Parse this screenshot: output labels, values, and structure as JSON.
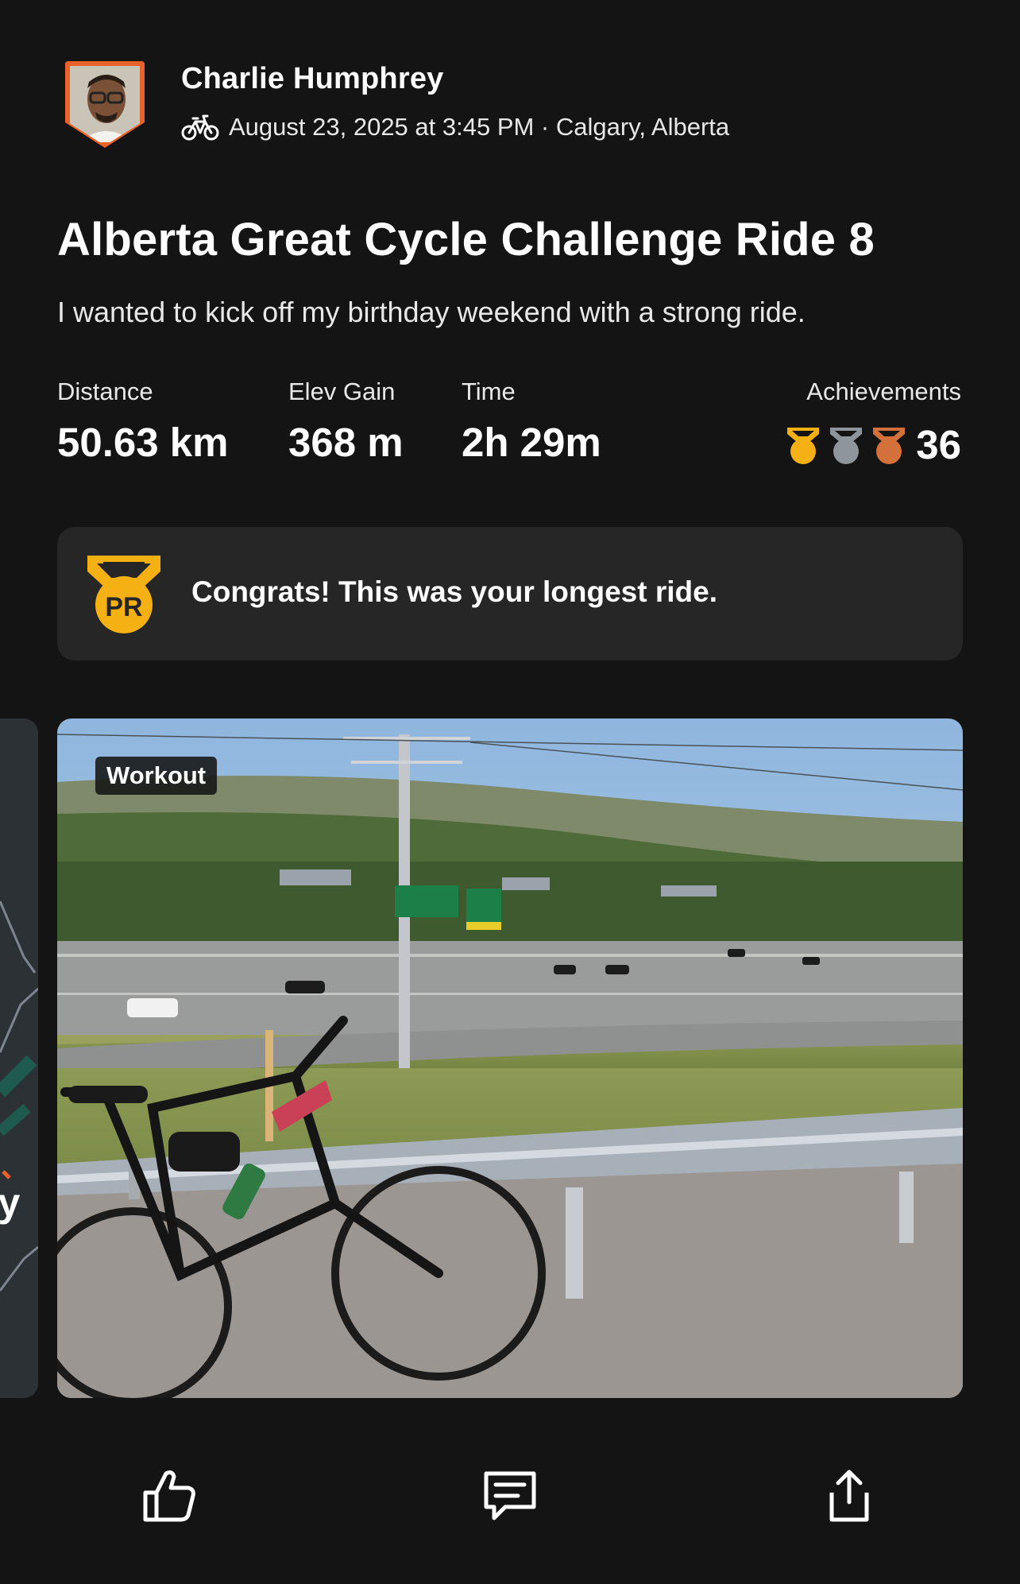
{
  "activity": {
    "athlete_name": "Charlie Humphrey",
    "activity_icon": "bike-icon",
    "datetime_location": "August 23, 2025 at 3:45 PM · Calgary, Alberta",
    "title": "Alberta Great Cycle Challenge Ride 8",
    "description": "I wanted to kick off my birthday weekend with a strong ride."
  },
  "stats": {
    "distance_label": "Distance",
    "distance_value": "50.63 km",
    "elev_label": "Elev Gain",
    "elev_value": "368 m",
    "time_label": "Time",
    "time_value": "2h 29m",
    "achievements_label": "Achievements",
    "achievements_count": "36",
    "medal_colors": [
      "#f5b014",
      "#8e969c",
      "#d4703a"
    ]
  },
  "pr_banner": {
    "icon": "pr-medal-icon",
    "text": "Congrats! This was your longest ride."
  },
  "media": {
    "map_peek_label": "ry",
    "photo_badge": "Workout"
  },
  "actions": {
    "icons": [
      "thumbs-up-icon",
      "comment-icon",
      "share-icon"
    ]
  },
  "colors": {
    "background": "#141414",
    "card": "#262626",
    "gold": "#f5b014",
    "avatar_frame": "#e8622a"
  }
}
